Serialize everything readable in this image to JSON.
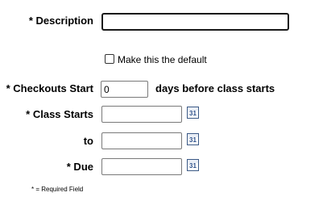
{
  "form": {
    "description_label": "* Description",
    "description_value": "",
    "default_checkbox_label": "Make this the default",
    "default_checked": false,
    "checkouts_start_label": "* Checkouts Start",
    "checkouts_start_value": "0",
    "checkouts_start_suffix": "days before class starts",
    "class_starts_label": "* Class Starts",
    "class_starts_value": "",
    "to_label": "to",
    "to_value": "",
    "due_label": "* Due",
    "due_value": "",
    "calendar_icon_text": "31",
    "required_note": "* = Required Field"
  }
}
